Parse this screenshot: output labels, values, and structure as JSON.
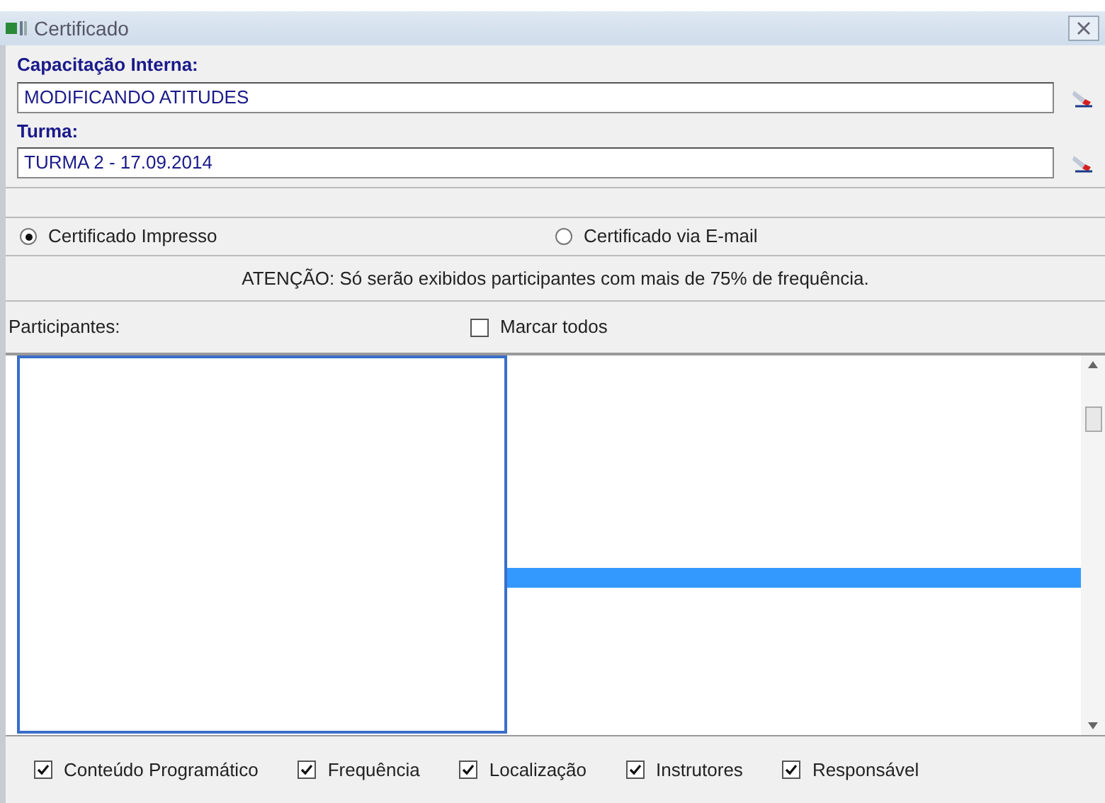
{
  "window": {
    "title": "Certificado"
  },
  "fields": [
    {
      "label": "Capacitação Interna:",
      "value": "MODIFICANDO ATITUDES"
    },
    {
      "label": "Turma:",
      "value": "TURMA 2 - 17.09.2014"
    }
  ],
  "delivery": [
    {
      "label": "Certificado Impresso",
      "selected": true
    },
    {
      "label": "Certificado via E-mail",
      "selected": false
    }
  ],
  "notice": "ATENÇÃO: Só serão exibidos participantes com mais de 75% de frequência.",
  "participants": {
    "label": "Participantes:",
    "mark_all": {
      "label": "Marcar todos",
      "checked": false
    }
  },
  "options": [
    {
      "label": "Conteúdo Programático",
      "checked": true
    },
    {
      "label": "Frequência",
      "checked": true
    },
    {
      "label": "Localização",
      "checked": true
    },
    {
      "label": "Instrutores",
      "checked": true
    },
    {
      "label": "Responsável",
      "checked": true
    }
  ]
}
